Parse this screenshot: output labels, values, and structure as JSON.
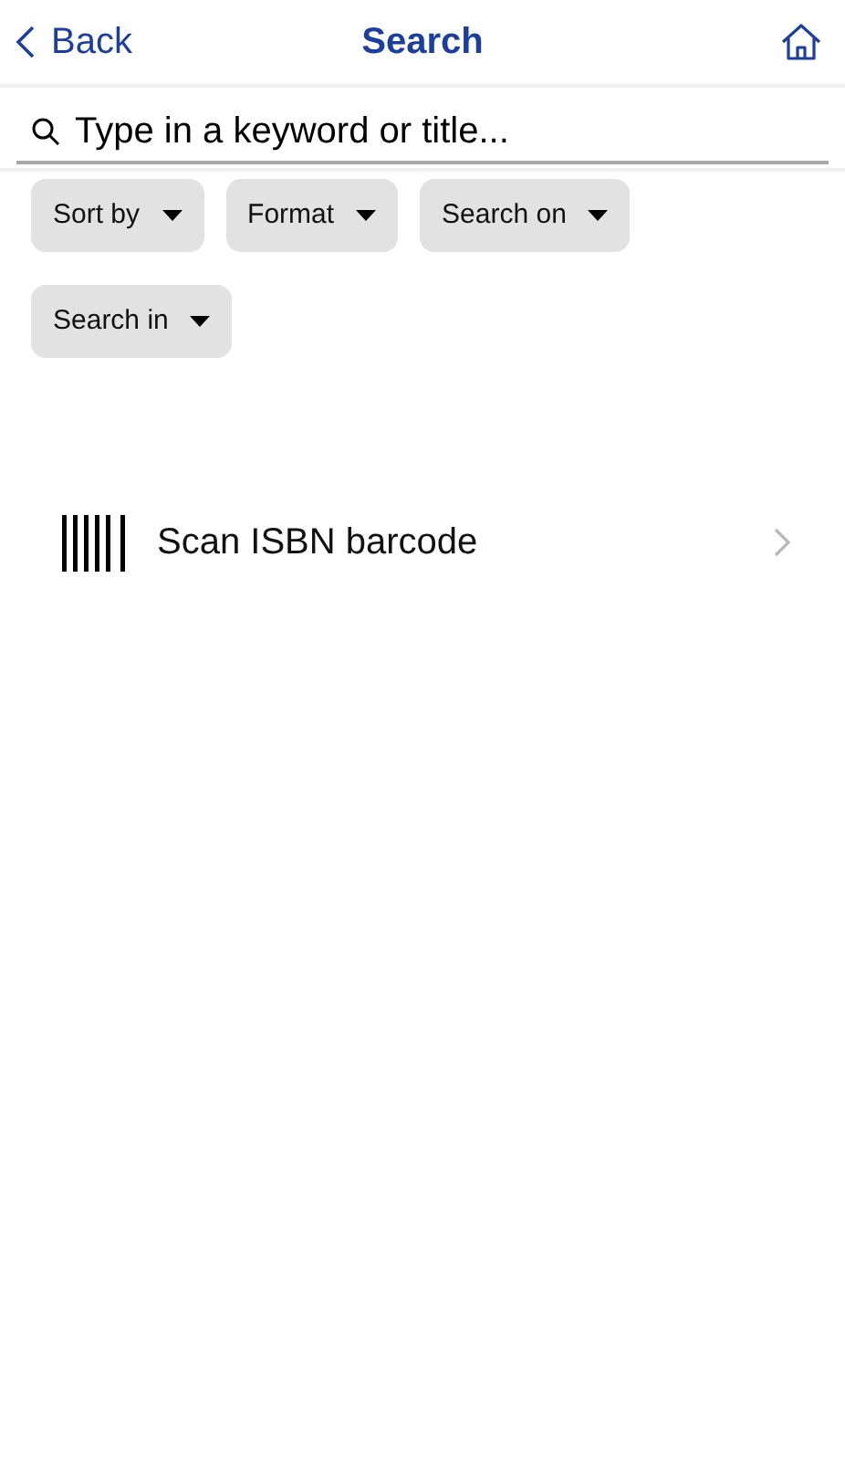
{
  "nav": {
    "back": "Back",
    "title": "Search"
  },
  "search": {
    "placeholder": "Type in a keyword or title..."
  },
  "filters": [
    {
      "label": "Sort by"
    },
    {
      "label": "Format"
    },
    {
      "label": "Search on"
    },
    {
      "label": "Search in"
    }
  ],
  "actions": [
    {
      "label": "Scan ISBN barcode"
    }
  ]
}
